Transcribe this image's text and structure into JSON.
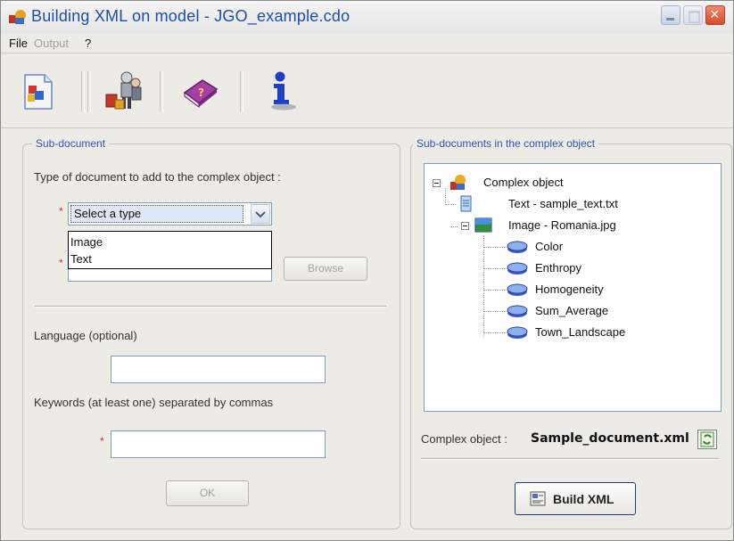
{
  "window": {
    "title": "Building XML on model - JGO_example.cdo",
    "close_glyph": "×"
  },
  "menu": {
    "file": "File",
    "output": "Output",
    "help": "?"
  },
  "toolbar": {
    "icons": [
      "new-document-icon",
      "workers-icon",
      "help-book-icon",
      "info-icon"
    ]
  },
  "sub_document": {
    "legend": "Sub-document",
    "type_label": "Type of document to add to the complex object :",
    "type_select_value": "Select a type",
    "type_options": [
      "Image",
      "Text"
    ],
    "browse_label": "Browse",
    "language_label": "Language (optional)",
    "language_value": "",
    "keywords_label": "Keywords (at least one) separated by commas",
    "keywords_value": "",
    "ok_label": "OK",
    "required_mark": "*"
  },
  "tree_panel": {
    "legend": "Sub-documents in the complex object",
    "root": "Complex object",
    "text_item": "Text - sample_text.txt",
    "image_item": "Image - Romania.jpg",
    "features": [
      "Color",
      "Enthropy",
      "Homogeneity",
      "Sum_Average",
      "Town_Landscape"
    ]
  },
  "complex_object": {
    "label": "Complex object :",
    "value": "Sample_document.xml"
  },
  "build_button": {
    "label": "Build XML"
  },
  "colors": {
    "title_text": "#1b4fa8",
    "legend_text": "#2f56b5",
    "required": "#d92b2b",
    "window_bg": "#ecebe6"
  }
}
